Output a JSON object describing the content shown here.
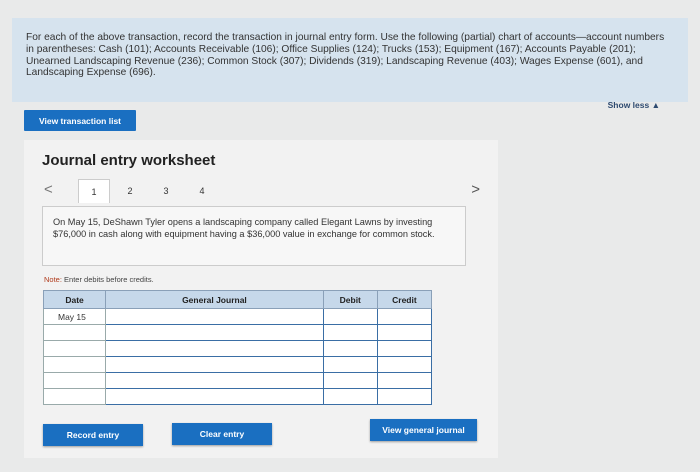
{
  "instructions": {
    "text": "For each of the above transaction, record the transaction in journal entry form. Use the following (partial) chart of accounts—account numbers in parentheses: Cash (101); Accounts Receivable (106); Office Supplies (124); Trucks (153); Equipment (167); Accounts Payable (201); Unearned Landscaping Revenue (236); Common Stock (307); Dividends (319); Landscaping Revenue (403); Wages Expense (601), and Landscaping Expense (696).",
    "show_less": "Show less ▲"
  },
  "view_transaction_list": "View transaction list",
  "worksheet": {
    "title": "Journal entry worksheet",
    "pages": [
      "1",
      "2",
      "3",
      "4"
    ],
    "active_page": "1",
    "prev": "<",
    "next": ">",
    "transaction": "On May 15, DeShawn Tyler opens a landscaping company called Elegant Lawns by investing $76,000 in cash along with equipment having a $36,000 value in exchange for common stock.",
    "note_label": "Note:",
    "note_text": "Enter debits before credits.",
    "table": {
      "headers": [
        "Date",
        "General Journal",
        "Debit",
        "Credit"
      ],
      "date_value": "May 15"
    },
    "buttons": {
      "record": "Record entry",
      "clear": "Clear entry",
      "view_journal": "View general journal"
    }
  }
}
